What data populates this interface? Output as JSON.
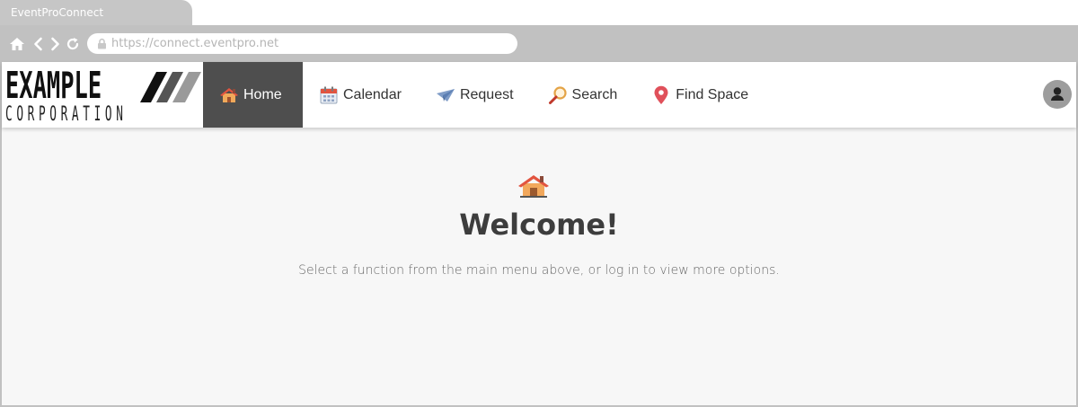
{
  "browser": {
    "tab_title": "EventProConnect",
    "url": "https://connect.eventpro.net"
  },
  "logo": {
    "line1": "EXAMPLE",
    "line2": "CORPORATION"
  },
  "nav": {
    "items": [
      {
        "label": "Home",
        "icon": "house-icon",
        "active": true
      },
      {
        "label": "Calendar",
        "icon": "calendar-icon",
        "active": false
      },
      {
        "label": "Request",
        "icon": "paper-plane-icon",
        "active": false
      },
      {
        "label": "Search",
        "icon": "magnifier-icon",
        "active": false
      },
      {
        "label": "Find Space",
        "icon": "map-pin-icon",
        "active": false
      }
    ]
  },
  "main": {
    "title": "Welcome!",
    "subtitle": "Select a function from the main menu above, or log in to view more options."
  },
  "colors": {
    "nav_active": "#4e4e4e",
    "chrome": "#c1c1c1",
    "page_bg": "#f7f7f7"
  }
}
